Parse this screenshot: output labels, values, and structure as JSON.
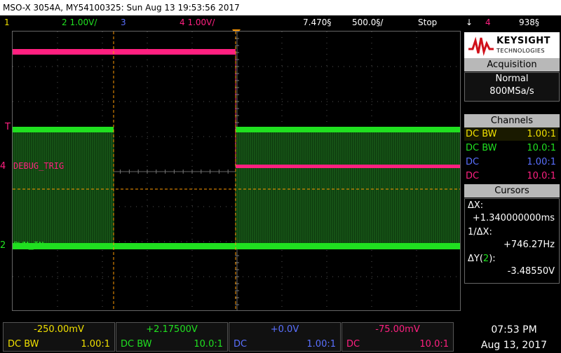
{
  "title_bar": "MSO-X 3054A, MY54100325: Sun Aug 13 19:53:56 2017",
  "status_bar": {
    "ch1_num": "1",
    "ch2": "2  1.00V/",
    "ch3_num": "3",
    "ch4": "4  1.00V/",
    "time_pos": "7.470§",
    "time_div": "500.0§/",
    "run_state": "Stop",
    "trigger_icon": "↓",
    "trigger_ch": "4",
    "trigger_level": "938§"
  },
  "colors": {
    "ch1": "#f0e000",
    "ch2": "#20e020",
    "ch3": "#5a70ff",
    "ch4": "#ff2080",
    "cursor": "#ff9a00"
  },
  "waveform_labels": {
    "debug": "DEBUG_TRIG",
    "pwm": "PWM_IN",
    "ch4_marker": "4",
    "ch2_marker": "2",
    "trigger_marker": "T"
  },
  "panel": {
    "logo_line1": "KEYSIGHT",
    "logo_line2": "TECHNOLOGIES",
    "acquisition_title": "Acquisition",
    "acq_mode": "Normal",
    "acq_rate": "800MSa/s",
    "channels_title": "Channels",
    "channels": [
      {
        "coupling": "DC BW",
        "probe": "1.00:1"
      },
      {
        "coupling": "DC BW",
        "probe": "10.0:1"
      },
      {
        "coupling": "DC",
        "probe": "1.00:1"
      },
      {
        "coupling": "DC",
        "probe": "10.0:1"
      }
    ],
    "cursors_title": "Cursors",
    "dx_label": "ΔX:",
    "dx_value": "+1.340000000ms",
    "inv_dx_label": "1/ΔX:",
    "inv_dx_value": "+746.27Hz",
    "dy_label_prefix": "ΔY(",
    "dy_label_ch": "2",
    "dy_label_suffix": "):",
    "dy_value": "-3.48550V"
  },
  "bottom": {
    "ch1_offset": "-250.00mV",
    "ch1_coupling": "DC  BW",
    "ch1_probe": "1.00:1",
    "ch2_offset": "+2.17500V",
    "ch2_coupling": "DC  BW",
    "ch2_probe": "10.0:1",
    "ch3_offset": "+0.0V",
    "ch3_coupling": "DC",
    "ch3_probe": "1.00:1",
    "ch4_offset": "-75.00mV",
    "ch4_coupling": "DC",
    "ch4_probe": "10.0:1",
    "time": "07:53 PM",
    "date": "Aug 13, 2017"
  }
}
